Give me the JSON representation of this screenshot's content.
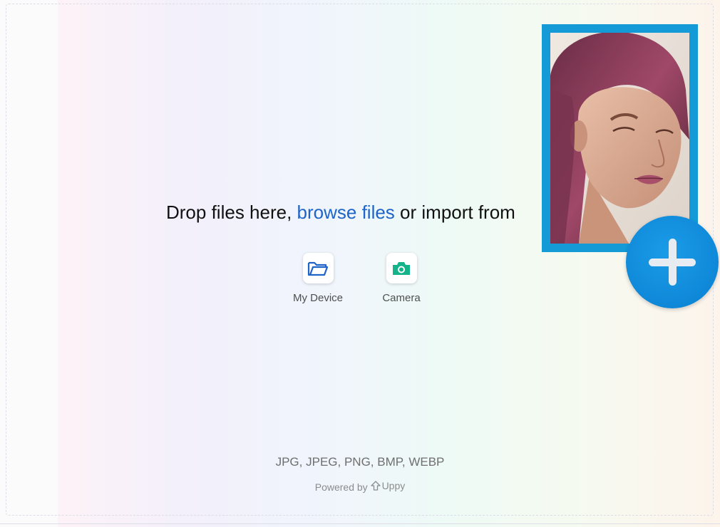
{
  "uploader": {
    "headline": {
      "prefix": "Drop files here, ",
      "browse_link": "browse files",
      "suffix": " or import from"
    },
    "sources": [
      {
        "label": "My Device",
        "icon": "folder-icon"
      },
      {
        "label": "Camera",
        "icon": "camera-icon"
      }
    ],
    "formats_note": "JPG, JPEG, PNG, BMP, WEBP",
    "powered_by": {
      "prefix": "Powered by ",
      "brand": "Uppy"
    }
  },
  "overlay": {
    "photo": "portrait-photo",
    "add_button_icon": "plus-icon"
  },
  "colors": {
    "link": "#1f64c8",
    "device_icon": "#1f64c8",
    "camera_icon": "#14b389",
    "card_frame": "#149bd7",
    "add_button": "#0a7fd1"
  }
}
